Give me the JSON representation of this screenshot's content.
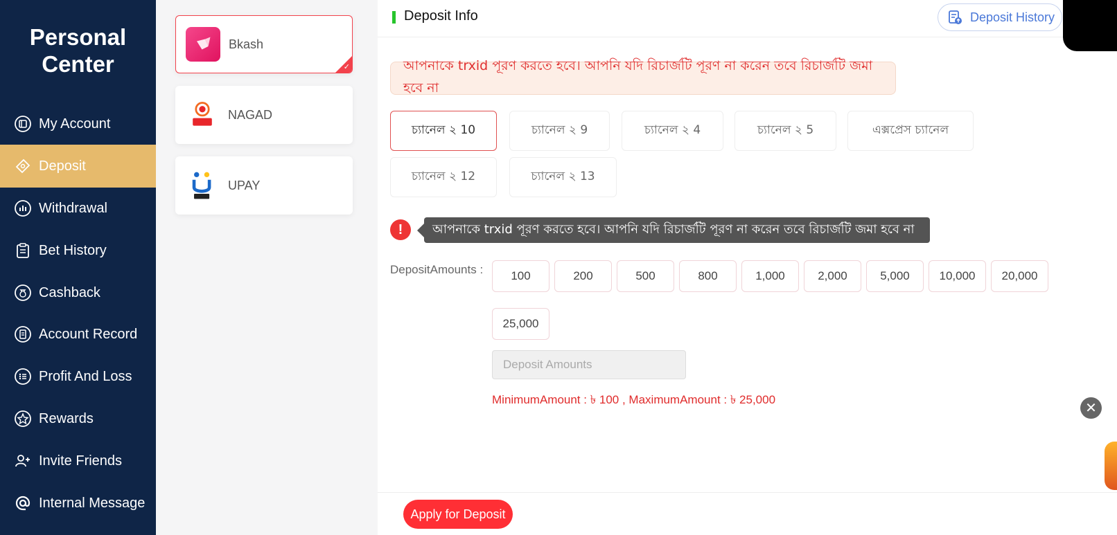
{
  "sidebar": {
    "title_line1": "Personal",
    "title_line2": "Center",
    "items": [
      {
        "label": "My Account",
        "icon": "wallet-icon"
      },
      {
        "label": "Deposit",
        "icon": "ticket-icon",
        "active": true
      },
      {
        "label": "Withdrawal",
        "icon": "chart-icon"
      },
      {
        "label": "Bet History",
        "icon": "clipboard-icon"
      },
      {
        "label": "Cashback",
        "icon": "money-bag-icon"
      },
      {
        "label": "Account Record",
        "icon": "document-icon"
      },
      {
        "label": "Profit And Loss",
        "icon": "list-icon"
      },
      {
        "label": "Rewards",
        "icon": "star-icon"
      },
      {
        "label": "Invite Friends",
        "icon": "add-user-icon"
      },
      {
        "label": "Internal Message",
        "icon": "at-icon"
      }
    ]
  },
  "methods": [
    {
      "label": "Bkash",
      "selected": true
    },
    {
      "label": "NAGAD"
    },
    {
      "label": "UPAY"
    }
  ],
  "header": {
    "title": "Deposit Info",
    "history_label": "Deposit History"
  },
  "notice": "আপনাকে trxid পূরণ করতে হবে। আপনি যদি রিচার্জটি পূরণ না করেন তবে রিচার্জটি জমা হবে না",
  "channels": [
    "চ্যানেল ২ 10",
    "চ্যানেল ২ 9",
    "চ্যানেল ২ 4",
    "চ্যানেল ২ 5",
    "এক্সপ্রেস চ্যানেল",
    "চ্যানেল ২ 12",
    "চ্যানেল ২ 13"
  ],
  "selected_channel": "চ্যানেল ২ 10",
  "warning_tooltip": "আপনাকে trxid পূরণ করতে হবে। আপনি যদি রিচার্জটি পূরণ না করেন তবে রিচার্জটি জমা হবে না",
  "amounts": {
    "label": "DepositAmounts :",
    "options": [
      "100",
      "200",
      "500",
      "800",
      "1,000",
      "2,000",
      "5,000",
      "10,000",
      "20,000",
      "25,000"
    ],
    "input_placeholder": "Deposit Amounts",
    "limits": "MinimumAmount : ৳ 100 , MaximumAmount : ৳ 25,000"
  },
  "footer": {
    "apply_label": "Apply for Deposit"
  },
  "colors": {
    "sidebar_bg": "#0f2547",
    "active_bg": "#e6ba6c",
    "accent_red": "#ff2f35",
    "accent_blue": "#4a78d8",
    "green_bar": "#27c52c"
  }
}
